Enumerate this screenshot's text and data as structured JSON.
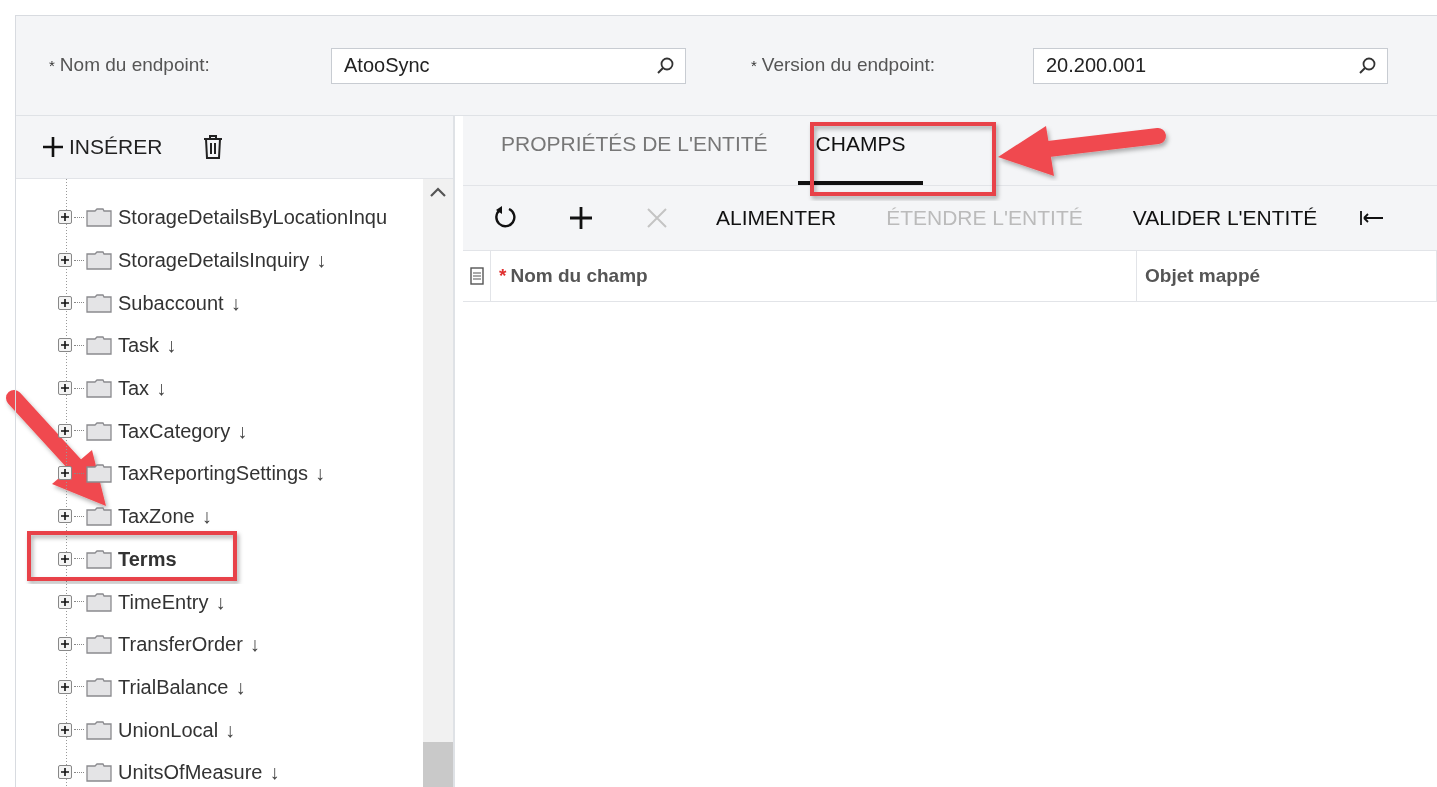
{
  "header_fields": [
    {
      "label": "Nom du endpoint:",
      "required_mark": "*",
      "value": "AtooSync"
    },
    {
      "label": "Version du endpoint:",
      "required_mark": "*",
      "value": "20.200.001"
    }
  ],
  "tree_toolbar": {
    "insert_label": "INSÉRER"
  },
  "tree": [
    {
      "label": "StorageDetailsByLocationInqu",
      "selected": false
    },
    {
      "label": "StorageDetailsInquiry",
      "marker": "↓",
      "selected": false
    },
    {
      "label": "Subaccount",
      "marker": "↓",
      "selected": false
    },
    {
      "label": "Task",
      "marker": "↓",
      "selected": false
    },
    {
      "label": "Tax",
      "marker": "↓",
      "selected": false
    },
    {
      "label": "TaxCategory",
      "marker": "↓",
      "selected": false
    },
    {
      "label": "TaxReportingSettings",
      "marker": "↓",
      "selected": false
    },
    {
      "label": "TaxZone",
      "marker": "↓",
      "selected": false
    },
    {
      "label": "Terms",
      "selected": true
    },
    {
      "label": "TimeEntry",
      "marker": "↓",
      "selected": false
    },
    {
      "label": "TransferOrder",
      "marker": "↓",
      "selected": false
    },
    {
      "label": "TrialBalance",
      "marker": "↓",
      "selected": false
    },
    {
      "label": "UnionLocal",
      "marker": "↓",
      "selected": false
    },
    {
      "label": "UnitsOfMeasure",
      "marker": "↓",
      "selected": false
    }
  ],
  "tabs": [
    {
      "label": "PROPRIÉTÉS DE L'ENTITÉ",
      "selected": false
    },
    {
      "label": "CHAMPS",
      "selected": true
    }
  ],
  "toolbar": {
    "icon_buttons": [
      {
        "disabled": false
      },
      {
        "disabled": false
      },
      {
        "disabled": true
      }
    ],
    "text_buttons": [
      {
        "label": "ALIMENTER",
        "disabled": false
      },
      {
        "label": "ÉTENDRE L'ENTITÉ",
        "disabled": true
      },
      {
        "label": "VALIDER L'ENTITÉ",
        "disabled": false
      }
    ]
  },
  "grid": {
    "columns": [
      {
        "label": "Nom du champ",
        "required_mark": "*"
      },
      {
        "label": "Objet mappé"
      }
    ]
  }
}
